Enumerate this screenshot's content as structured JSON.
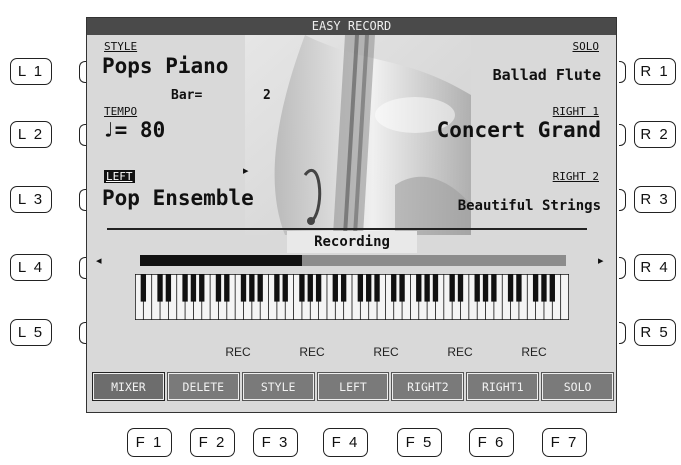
{
  "screen": {
    "title": "EASY RECORD",
    "style_label": "STYLE",
    "style_value": "Pops Piano",
    "bar_label": "Bar=",
    "bar_value": "2",
    "tempo_label": "TEMPO",
    "tempo_value": "♩= 80",
    "left_label": "LEFT",
    "left_value": "Pop Ensemble",
    "solo_label": "SOLO",
    "solo_value": "Ballad Flute",
    "right1_label": "RIGHT 1",
    "right1_value": "Concert Grand",
    "right2_label": "RIGHT 2",
    "right2_value": "Beautiful Strings",
    "status": "Recording",
    "progress_fraction": 0.38,
    "rec_label": "REC",
    "soft_buttons": [
      "MIXER",
      "DELETE",
      "STYLE",
      "LEFT",
      "RIGHT2",
      "RIGHT1",
      "SOLO"
    ],
    "icons": {
      "play_marker": "▸",
      "arrow_left": "◂",
      "arrow_right": "▸"
    }
  },
  "hardware": {
    "left": [
      "L 1",
      "L 2",
      "L 3",
      "L 4",
      "L 5"
    ],
    "right": [
      "R 1",
      "R 2",
      "R 3",
      "R 4",
      "R 5"
    ],
    "bottom": [
      "F 1",
      "F 2",
      "F 3",
      "F 4",
      "F 5",
      "F 6",
      "F 7"
    ]
  },
  "colors": {
    "screen_bg": "#d9d9d9",
    "title_bar": "#4a4a4a",
    "soft_button": "#7a7a7a"
  }
}
